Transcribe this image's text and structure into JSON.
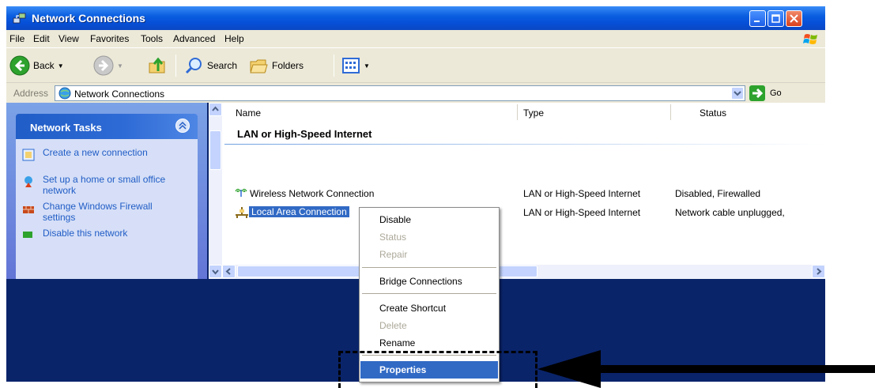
{
  "window": {
    "title": "Network Connections"
  },
  "menu": [
    "File",
    "Edit",
    "View",
    "Favorites",
    "Tools",
    "Advanced",
    "Help"
  ],
  "toolbar": {
    "back": "Back",
    "search": "Search",
    "folders": "Folders"
  },
  "address": {
    "label": "Address",
    "value": "Network Connections",
    "go": "Go"
  },
  "tasks": {
    "header": "Network Tasks",
    "items": [
      "Create a new connection",
      "Set up a home or small office network",
      "Change Windows Firewall settings",
      "Disable this network"
    ]
  },
  "list": {
    "columns": [
      "Name",
      "Type",
      "Status"
    ],
    "group": "LAN or High-Speed Internet",
    "rows": [
      {
        "name": "Wireless Network Connection",
        "type": "LAN or High-Speed Internet",
        "status": "Disabled, Firewalled"
      },
      {
        "name": "Local Area Connection",
        "type": "LAN or High-Speed Internet",
        "status": "Network cable unplugged,"
      }
    ]
  },
  "context_menu": {
    "items": [
      "Disable",
      "Status",
      "Repair",
      "Bridge Connections",
      "Create Shortcut",
      "Delete",
      "Rename",
      "Properties"
    ]
  },
  "colors": {
    "selection": "#316ac5",
    "titlebar": "#0a5ee0",
    "desktop": "#0a246a"
  }
}
